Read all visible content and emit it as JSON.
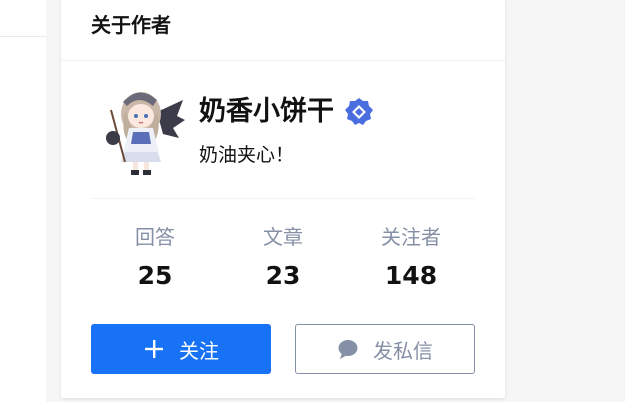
{
  "card": {
    "title": "关于作者"
  },
  "author": {
    "name": "奶香小饼干",
    "headline": "奶油夹心！",
    "badge_icon": "verified-badge-icon",
    "badge_color": "#4a6ee0"
  },
  "stats": [
    {
      "label": "回答",
      "value": "25"
    },
    {
      "label": "文章",
      "value": "23"
    },
    {
      "label": "关注者",
      "value": "148"
    }
  ],
  "actions": {
    "follow_label": "关注",
    "follow_icon": "plus-icon",
    "message_label": "发私信",
    "message_icon": "chat-bubble-icon"
  },
  "colors": {
    "primary": "#1772f6",
    "muted": "#8590a6",
    "text": "#121212"
  }
}
